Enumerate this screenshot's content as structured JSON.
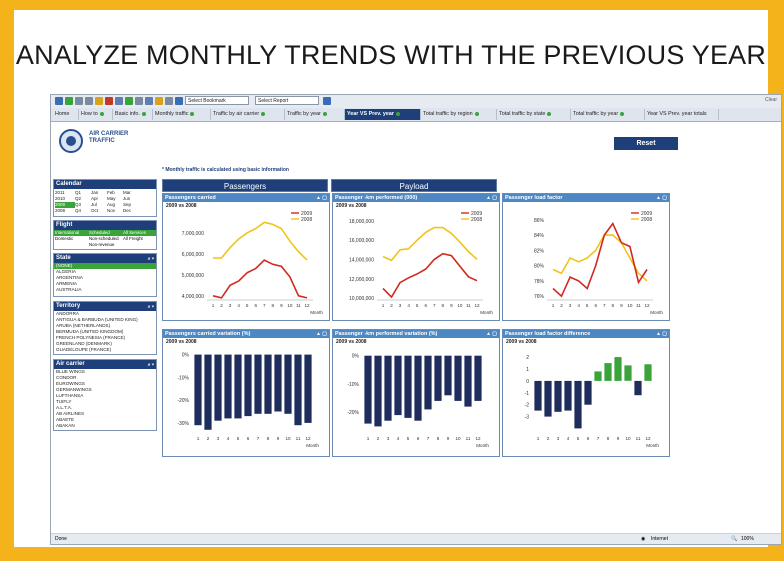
{
  "slide_title": "ANALYZE MONTHLY TRENDS WITH THE PREVIOUS YEAR",
  "toolbar": {
    "bookmark_placeholder": "Select Bookmark",
    "report_placeholder": "Select Report",
    "clear_label": "Clear"
  },
  "tabs": [
    {
      "label": "Home"
    },
    {
      "label": "How to"
    },
    {
      "label": "Basic info."
    },
    {
      "label": "Monthly traffic"
    },
    {
      "label": "Traffic by air carrier"
    },
    {
      "label": "Traffic by year"
    },
    {
      "label": "Year VS Prev. year"
    },
    {
      "label": "Total traffic by region"
    },
    {
      "label": "Total traffic by state"
    },
    {
      "label": "Total traffic by year"
    },
    {
      "label": "Year VS Prev. year totals"
    }
  ],
  "logo_text": "AIR CARRIER TRAFFIC",
  "reset_label": "Reset",
  "note": "* Monthly traffic is calculated using basic information",
  "calendar": {
    "title": "Calendar",
    "years": [
      "2011",
      "2010",
      "2009",
      "2008"
    ],
    "quarters": [
      "Q1",
      "Q2",
      "Q3",
      "Q4"
    ],
    "months": [
      [
        "Jan",
        "Feb",
        "Mar"
      ],
      [
        "Apr",
        "May",
        "Jun"
      ],
      [
        "Jul",
        "Aug",
        "Sep"
      ],
      [
        "Oct",
        "Nov",
        "Dec"
      ]
    ]
  },
  "flight": {
    "title": "Flight",
    "rows": [
      [
        "International",
        "Scheduled",
        "All Services"
      ],
      [
        "Domestic",
        "Non-scheduled",
        "All Freight"
      ],
      [
        "",
        "Non-revenue",
        ""
      ]
    ]
  },
  "state": {
    "title": "State",
    "items": [
      "(NONE)",
      "ALGERIA",
      "ARGENTINA",
      "ARMENIA",
      "AUSTRALIA"
    ]
  },
  "territory": {
    "title": "Territory",
    "items": [
      "ANDORRA",
      "ANTIGUA & BARBUDA (UNITED KING)",
      "ARUBA (NETHERLANDS)",
      "BERMUDA (UNITED KINGDOM)",
      "FRENCH POLYNESIA (FRANCE)",
      "GREENLAND (DENMARK)",
      "GUADELOUPE (FRANCE)"
    ]
  },
  "carrier": {
    "title": "Air carrier",
    "items": [
      "BLUE WINGS",
      "CONDOR",
      "EUROWINGS",
      "GERMANWINGS",
      "LUFTHANSA",
      "TUIFLY",
      "A.L.T.A.",
      "AB AIRLINES",
      "ABAETE",
      "ABAKAN"
    ]
  },
  "sections": {
    "passengers": "Passengers",
    "payload": "Payload"
  },
  "panels": {
    "p1": {
      "title": "Passengers carried",
      "subtitle": "2009 vs 2008"
    },
    "p2": {
      "title": "Passenger -km performed (000)",
      "subtitle": "2009 vs 2008"
    },
    "p3": {
      "title": "Passenger load factor",
      "subtitle": ""
    },
    "p4": {
      "title": "Passengers carried variation (%)",
      "subtitle": "2009 vs 2008"
    },
    "p5": {
      "title": "Passenger -km performed variation (%)",
      "subtitle": "2009 vs 2008"
    },
    "p6": {
      "title": "Passenger load factor difference",
      "subtitle": "2009 vs 2008"
    }
  },
  "colors": {
    "y2009": "#cf2a20",
    "y2008": "#f0c419",
    "bar": "#1f2d5c",
    "bar_pos": "#3aa33a",
    "header": "#1e3f7a",
    "panel_head": "#4d88c4"
  },
  "status": {
    "left": "Done",
    "zone": "Internet",
    "zoom": "100%"
  },
  "chart_data": [
    {
      "type": "line",
      "title": "Passengers carried",
      "xlabel": "Month",
      "x": [
        1,
        2,
        3,
        4,
        5,
        6,
        7,
        8,
        9,
        10,
        11,
        12
      ],
      "ylim": [
        3800000,
        7800000
      ],
      "yticks": [
        4000000,
        5000000,
        6000000,
        7000000
      ],
      "yticklabels": [
        "4,000,000",
        "5,000,000",
        "6,000,000",
        "7,000,000"
      ],
      "series": [
        {
          "name": "2009",
          "values": [
            4000000,
            3900000,
            4500000,
            4700000,
            5100000,
            5300000,
            5700000,
            5500000,
            5400000,
            4900000,
            4000000,
            3900000
          ]
        },
        {
          "name": "2008",
          "values": [
            5800000,
            5800000,
            6300000,
            6700000,
            7000000,
            7200000,
            7500000,
            7400000,
            7200000,
            6600000,
            6100000,
            5700000
          ]
        }
      ]
    },
    {
      "type": "line",
      "title": "Passenger -km performed (000)",
      "xlabel": "Month",
      "x": [
        1,
        2,
        3,
        4,
        5,
        6,
        7,
        8,
        9,
        10,
        11,
        12
      ],
      "ylim": [
        9800000,
        18500000
      ],
      "yticks": [
        10000000,
        12000000,
        14000000,
        16000000,
        18000000
      ],
      "yticklabels": [
        "10,000,000",
        "12,000,000",
        "14,000,000",
        "16,000,000",
        "18,000,000"
      ],
      "series": [
        {
          "name": "2009",
          "values": [
            11000000,
            10100000,
            11600000,
            12100000,
            12500000,
            13000000,
            14000000,
            14600000,
            14400000,
            13300000,
            12200000,
            11800000
          ]
        },
        {
          "name": "2008",
          "values": [
            14300000,
            13900000,
            15000000,
            15100000,
            16000000,
            16800000,
            17300000,
            17300000,
            16700000,
            15800000,
            14800000,
            14000000
          ]
        }
      ]
    },
    {
      "type": "line",
      "title": "Passenger load factor",
      "xlabel": "Month",
      "x": [
        1,
        2,
        3,
        4,
        5,
        6,
        7,
        8,
        9,
        10,
        11,
        12
      ],
      "ylim": [
        75.5,
        86.5
      ],
      "yticks": [
        76,
        78,
        80,
        82,
        84,
        86
      ],
      "yticklabels": [
        "76%",
        "78%",
        "80%",
        "82%",
        "84%",
        "86%"
      ],
      "series": [
        {
          "name": "2009",
          "values": [
            77.0,
            76.0,
            78.5,
            78.0,
            77.0,
            80.0,
            84.0,
            85.5,
            83.0,
            82.5,
            77.8,
            79.5
          ]
        },
        {
          "name": "2008",
          "values": [
            79.5,
            79.0,
            81.0,
            80.5,
            81.0,
            82.0,
            84.0,
            84.0,
            83.0,
            81.0,
            79.0,
            78.0
          ]
        }
      ]
    },
    {
      "type": "bar",
      "title": "Passengers carried variation (%)",
      "xlabel": "Month",
      "categories": [
        "1",
        "2",
        "3",
        "4",
        "5",
        "6",
        "7",
        "8",
        "9",
        "10",
        "11",
        "12"
      ],
      "values": [
        -31,
        -33,
        -29,
        -28,
        -28,
        -27,
        -26,
        -26,
        -25,
        -26,
        -31,
        -30
      ],
      "ylim": [
        -34,
        2
      ],
      "yticks": [
        0,
        -10,
        -20,
        -30
      ],
      "yticklabels": [
        "0%",
        "-10%",
        "-20%",
        "-30%"
      ]
    },
    {
      "type": "bar",
      "title": "Passenger -km performed variation (%)",
      "xlabel": "Month",
      "categories": [
        "1",
        "2",
        "3",
        "4",
        "5",
        "6",
        "7",
        "8",
        "9",
        "10",
        "11",
        "12"
      ],
      "values": [
        -24,
        -25,
        -23,
        -21,
        -22,
        -23,
        -19,
        -16,
        -14,
        -16,
        -18,
        -16
      ],
      "ylim": [
        -27,
        2
      ],
      "yticks": [
        0,
        -10,
        -20
      ],
      "yticklabels": [
        "0%",
        "-10%",
        "-20%"
      ]
    },
    {
      "type": "bar",
      "title": "Passenger load factor difference",
      "xlabel": "Month",
      "categories": [
        "1",
        "2",
        "3",
        "4",
        "5",
        "6",
        "7",
        "8",
        "9",
        "10",
        "11",
        "12"
      ],
      "values": [
        -2.5,
        -3.0,
        -2.6,
        -2.5,
        -4.0,
        -2.0,
        0.8,
        1.5,
        2.0,
        1.3,
        -1.2,
        1.4
      ],
      "ylim": [
        -4.3,
        2.6
      ],
      "yticks": [
        2,
        1,
        0,
        -1,
        -2,
        -3
      ],
      "yticklabels": [
        "2",
        "1",
        "0",
        "-1",
        "-2",
        "-3"
      ]
    }
  ]
}
